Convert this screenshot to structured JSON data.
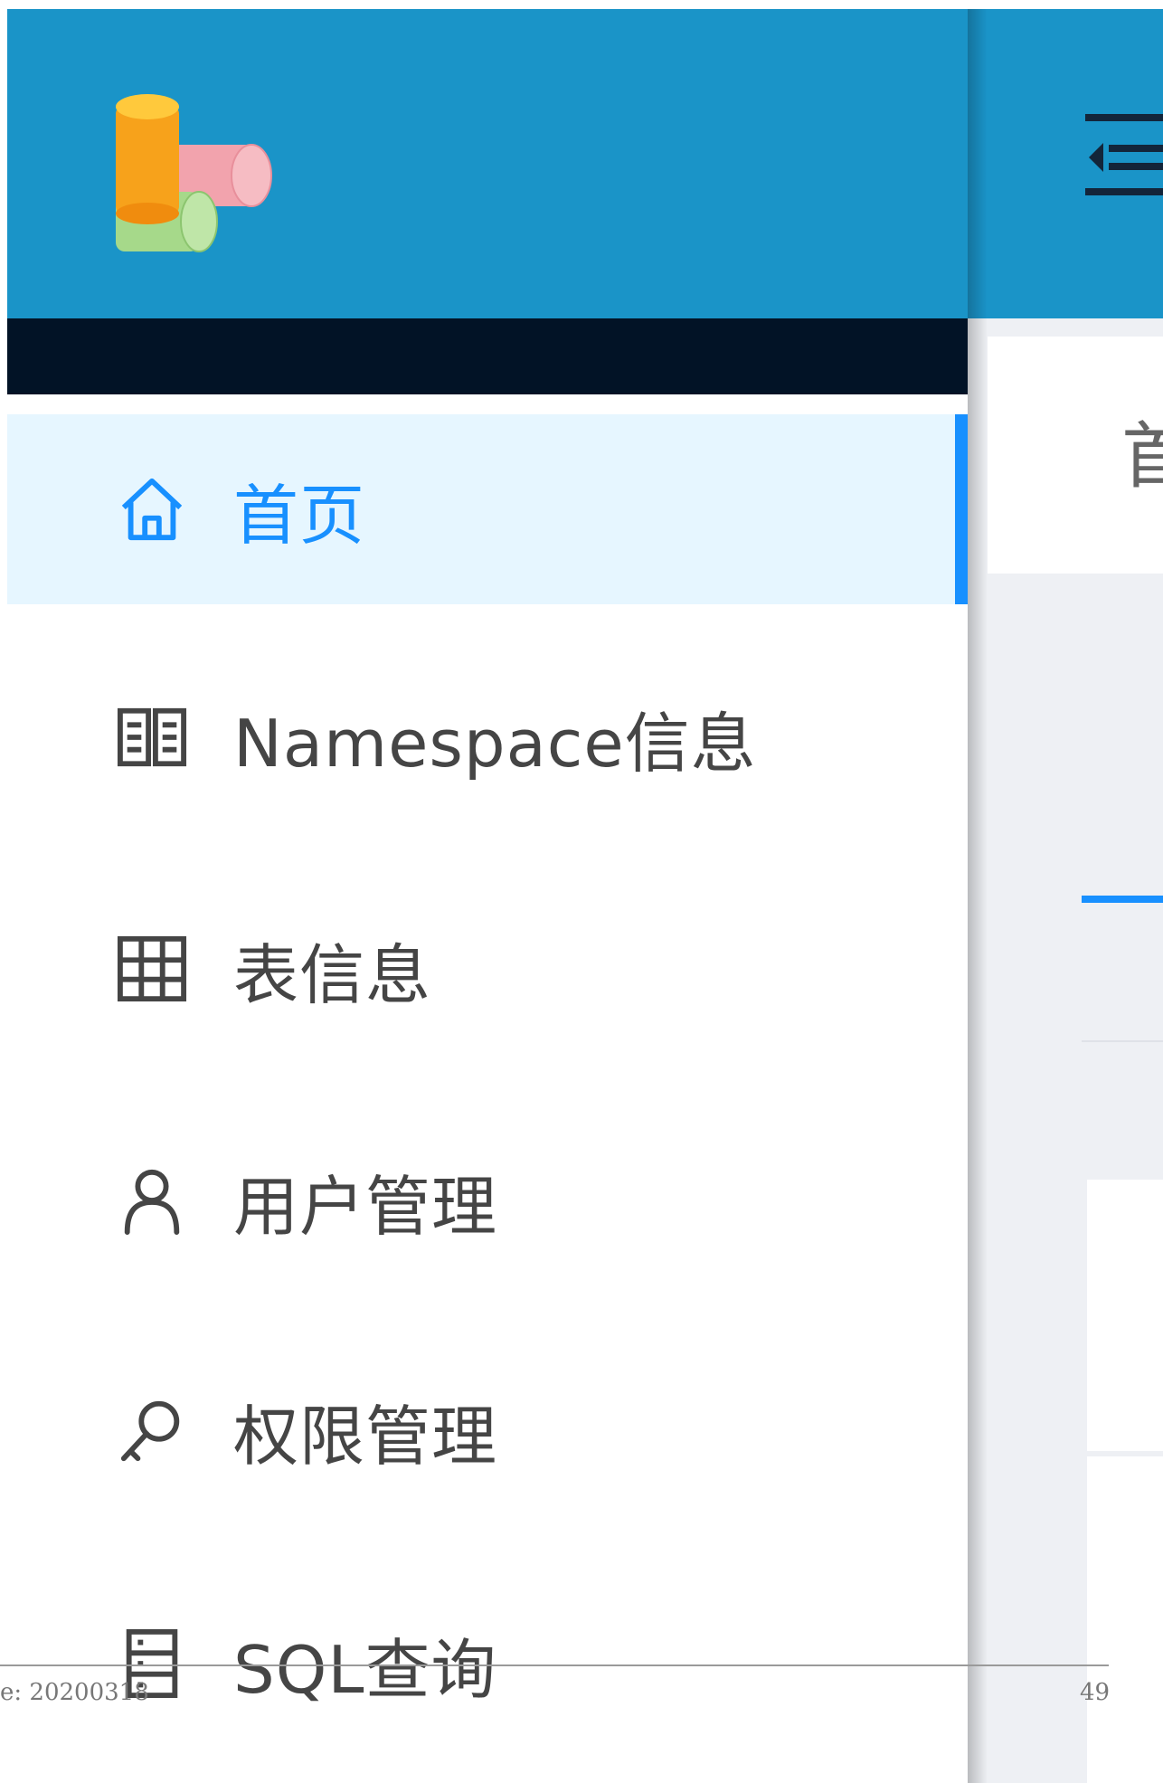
{
  "app": {
    "logo_icon": "db-stack-logo-icon",
    "colors": {
      "header": "#1a94c8",
      "dark_bar": "#021326",
      "accent": "#1890ff",
      "active_bg": "#e6f6ff"
    }
  },
  "sidebar": {
    "items": [
      {
        "label": "首页",
        "icon": "home-icon",
        "active": true
      },
      {
        "label": "Namespace信息",
        "icon": "book-icon",
        "active": false
      },
      {
        "label": "表信息",
        "icon": "table-icon",
        "active": false
      },
      {
        "label": "用户管理",
        "icon": "user-icon",
        "active": false
      },
      {
        "label": "权限管理",
        "icon": "key-icon",
        "active": false
      },
      {
        "label": "SQL查询",
        "icon": "database-icon",
        "active": false
      }
    ]
  },
  "header": {
    "collapse_icon": "menu-fold-icon"
  },
  "content": {
    "tab_partial": "首"
  },
  "footer": {
    "left": "e: 20200318",
    "page_number": "49"
  }
}
